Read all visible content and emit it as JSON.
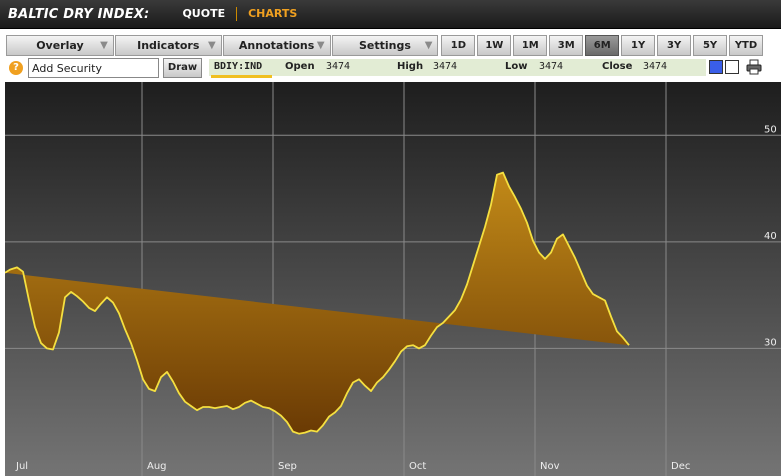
{
  "header": {
    "title": "BALTIC DRY INDEX:",
    "tabs": [
      {
        "label": "QUOTE",
        "active": false
      },
      {
        "label": "CHARTS",
        "active": true
      }
    ]
  },
  "toolbar": {
    "dropdowns": [
      {
        "label": "Overlay",
        "icon": "chevron-down-icon"
      },
      {
        "label": "Indicators",
        "icon": "chevron-down-icon"
      },
      {
        "label": "Annotations",
        "icon": "chevron-down-icon"
      },
      {
        "label": "Settings",
        "icon": "chevron-down-icon"
      }
    ],
    "periods": [
      {
        "label": "1D",
        "active": false
      },
      {
        "label": "1W",
        "active": false
      },
      {
        "label": "1M",
        "active": false
      },
      {
        "label": "3M",
        "active": false
      },
      {
        "label": "6M",
        "active": true
      },
      {
        "label": "1Y",
        "active": false
      },
      {
        "label": "3Y",
        "active": false
      },
      {
        "label": "5Y",
        "active": false
      },
      {
        "label": "YTD",
        "active": false
      }
    ]
  },
  "security": {
    "add_value": "Add Security",
    "draw_label": "Draw",
    "ticker": "BDIY:IND",
    "open_label": "Open",
    "open_value": "3474",
    "high_label": "High",
    "high_value": "3474",
    "low_label": "Low",
    "low_value": "3474",
    "close_label": "Close",
    "close_value": "3474",
    "colors": {
      "primary": "#3a5ee8",
      "secondary": "#ffffff"
    }
  },
  "chart_data": {
    "type": "area",
    "title": "",
    "xlabel": "",
    "ylabel": "",
    "ylim": [
      20,
      55
    ],
    "yticks": [
      30,
      40,
      50
    ],
    "months": [
      "Jul",
      "Aug",
      "Sep",
      "Oct",
      "Nov",
      "Dec"
    ],
    "grid": true,
    "line_color": "#f5e040",
    "fill_top_color": "#c28a18",
    "fill_bottom_color": "#6a3a04",
    "x": [
      0,
      5,
      12,
      18,
      24,
      30,
      36,
      42,
      48,
      54,
      60,
      66,
      72,
      78,
      84,
      90,
      96,
      102,
      108,
      114,
      120,
      126,
      132,
      138,
      144,
      150,
      156,
      162,
      168,
      174,
      180,
      186,
      192,
      198,
      204,
      210,
      216,
      222,
      228,
      234,
      240,
      246,
      252,
      258,
      264,
      270,
      276,
      282,
      288,
      294,
      300,
      306,
      312,
      318,
      324,
      330,
      336,
      342,
      348,
      354,
      360,
      366,
      372,
      378,
      384,
      390,
      396,
      402,
      408,
      414,
      420,
      426,
      432,
      438,
      444,
      450,
      456,
      462,
      468,
      474,
      480,
      486,
      492,
      498,
      504,
      510,
      516,
      522,
      528,
      534,
      540,
      546,
      552,
      558,
      564,
      570,
      576,
      582,
      588,
      594,
      600,
      606,
      612,
      618,
      624,
      630,
      636,
      642,
      648,
      654,
      660,
      666,
      672,
      678,
      684,
      690,
      696,
      702,
      708,
      714,
      720,
      726,
      732,
      738,
      744,
      750
    ],
    "y": [
      37.1,
      37.4,
      37.6,
      37.2,
      34.5,
      32.0,
      30.5,
      30.0,
      29.9,
      31.5,
      34.8,
      35.3,
      34.9,
      34.4,
      33.8,
      33.5,
      34.2,
      34.8,
      34.3,
      33.3,
      31.8,
      30.5,
      28.9,
      27.1,
      26.2,
      26.0,
      27.3,
      27.8,
      26.9,
      25.8,
      25.0,
      24.6,
      24.2,
      24.5,
      24.5,
      24.4,
      24.5,
      24.6,
      24.3,
      24.5,
      24.9,
      25.1,
      24.8,
      24.5,
      24.4,
      24.1,
      23.7,
      23.1,
      22.2,
      22.0,
      22.1,
      22.3,
      22.2,
      22.8,
      23.6,
      24.0,
      24.6,
      25.8,
      26.8,
      27.1,
      26.5,
      26.0,
      26.8,
      27.3,
      28.0,
      28.8,
      29.7,
      30.2,
      30.3,
      30.0,
      30.3,
      31.2,
      32.0,
      32.4,
      33.0,
      33.6,
      34.6,
      36.0,
      37.8,
      39.6,
      41.4,
      43.5,
      46.3,
      46.5,
      45.2,
      44.2,
      43.1,
      41.8,
      40.1,
      39.0,
      38.4,
      39.0,
      40.3,
      40.7,
      39.6,
      38.5,
      37.2,
      35.9,
      35.1,
      34.8,
      34.5,
      33.0,
      31.6,
      31.0,
      30.3
    ]
  }
}
